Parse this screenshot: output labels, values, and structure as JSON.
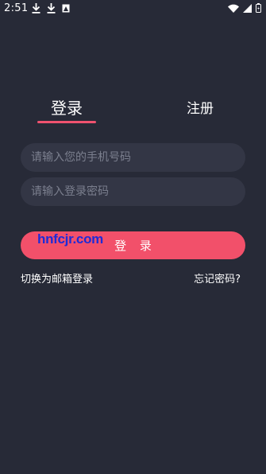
{
  "status_bar": {
    "time": "2:51",
    "left_icons": [
      "download-icon",
      "download-icon",
      "image-notification-icon"
    ],
    "right_icons": [
      "wifi-icon",
      "signal-icon",
      "battery-icon"
    ]
  },
  "tabs": [
    {
      "label": "登录",
      "active": true
    },
    {
      "label": "注册",
      "active": false
    }
  ],
  "form": {
    "phone_placeholder": "请输入您的手机号码",
    "phone_value": "",
    "password_placeholder": "请输入登录密码",
    "password_value": ""
  },
  "login_button_label": "登 录",
  "watermark": "hnfcjr.com",
  "links": {
    "switch_email": "切换为邮箱登录",
    "forgot_password": "忘记密码?"
  },
  "colors": {
    "background": "#272a37",
    "accent": "#f2506a",
    "field_background": "#333645"
  }
}
